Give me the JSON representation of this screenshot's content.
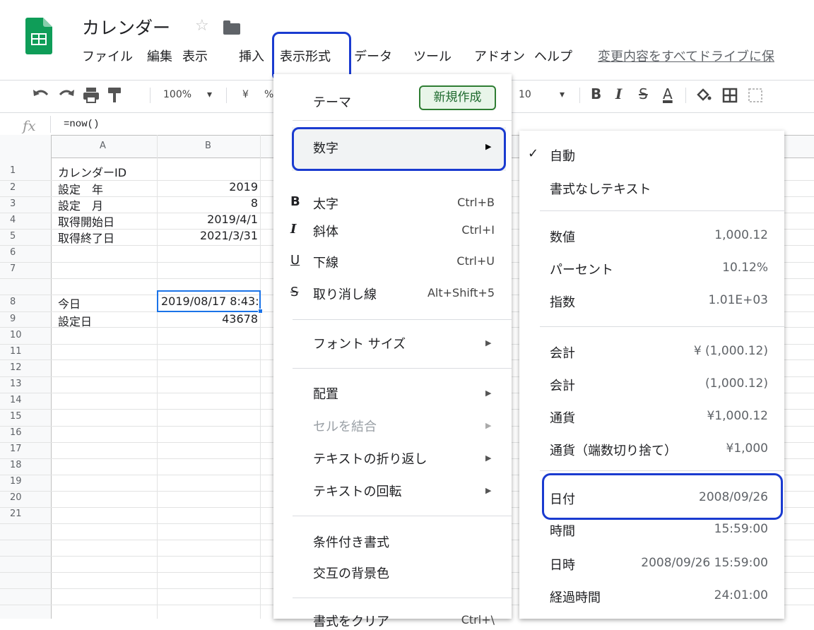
{
  "doc": {
    "title": "カレンダー",
    "star_icon": "☆"
  },
  "menu": [
    "ファイル",
    "編集",
    "表示",
    "挿入",
    "表示形式",
    "データ",
    "ツール",
    "アドオン",
    "ヘルプ"
  ],
  "menu_link": "変更内容をすべてドライブに保",
  "toolbar": {
    "zoom": "100%",
    "zoom_arrow": "▾",
    "currency": "¥",
    "percent": "%",
    "font_size": "10",
    "size_arrow": "▾",
    "bold": "B",
    "italic": "I",
    "strike": "S",
    "text_color": "A"
  },
  "formula": {
    "fx": "fx",
    "value": "=now()"
  },
  "columns": [
    "A",
    "B"
  ],
  "rows": [
    "1",
    "2",
    "3",
    "4",
    "5",
    "6",
    "7",
    "8",
    "9",
    "10",
    "11",
    "12",
    "13",
    "14",
    "15",
    "16",
    "17",
    "18",
    "19",
    "20",
    "21"
  ],
  "cells": {
    "a": [
      "カレンダーID",
      "設定　年",
      "設定　月",
      "取得開始日",
      "取得終了日",
      "",
      "今日",
      "設定日"
    ],
    "b": [
      "",
      "2019",
      "8",
      "2019/4/1",
      "2021/3/31",
      "",
      "2019/08/17 8:43:",
      "43678"
    ]
  },
  "format_menu": {
    "theme": "テーマ",
    "new_button": "新規作成",
    "number": "数字",
    "bold": {
      "label": "太字",
      "shortcut": "Ctrl+B",
      "icon": "B"
    },
    "italic": {
      "label": "斜体",
      "shortcut": "Ctrl+I",
      "icon": "I"
    },
    "underline": {
      "label": "下線",
      "shortcut": "Ctrl+U",
      "icon": "U"
    },
    "strike": {
      "label": "取り消し線",
      "shortcut": "Alt+Shift+5",
      "icon": "S"
    },
    "font_size": "フォント サイズ",
    "align": "配置",
    "merge": "セルを結合",
    "wrap": "テキストの折り返し",
    "rotate": "テキストの回転",
    "conditional": "条件付き書式",
    "alternating": "交互の背景色",
    "clear": "書式をクリア",
    "clear_shortcut": "Ctrl+\\",
    "arrow": "▶"
  },
  "number_menu": {
    "check": "✓",
    "auto": "自動",
    "plain": "書式なしテキスト",
    "items": [
      {
        "label": "数値",
        "value": "1,000.12"
      },
      {
        "label": "パーセント",
        "value": "10.12%"
      },
      {
        "label": "指数",
        "value": "1.01E+03"
      },
      {
        "label": "会計",
        "value": "¥ (1,000.12)"
      },
      {
        "label": "会計",
        "value": "(1,000.12)"
      },
      {
        "label": "通貨",
        "value": "¥1,000.12"
      },
      {
        "label": "通貨（端数切り捨て）",
        "value": "¥1,000"
      },
      {
        "label": "日付",
        "value": "2008/09/26"
      },
      {
        "label": "時間",
        "value": "15:59:00"
      },
      {
        "label": "日時",
        "value": "2008/09/26 15:59:00"
      },
      {
        "label": "経過時間",
        "value": "24:01:00"
      }
    ]
  }
}
